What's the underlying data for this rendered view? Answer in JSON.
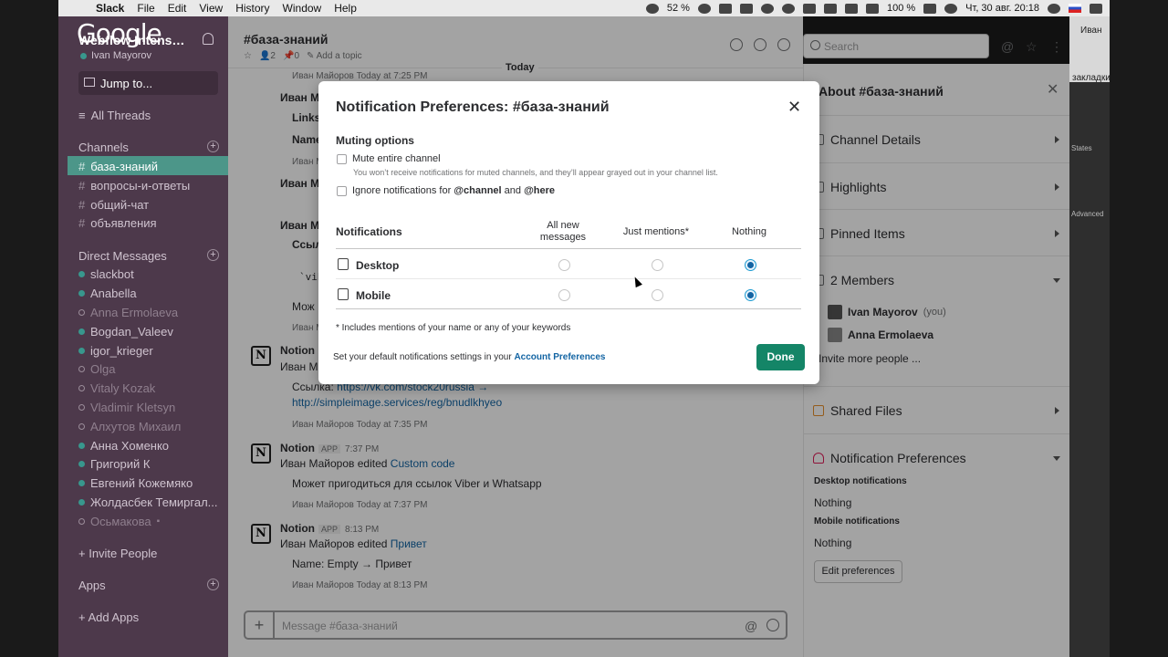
{
  "menubar": {
    "app": "Slack",
    "items": [
      "File",
      "Edit",
      "View",
      "History",
      "Window",
      "Help"
    ],
    "cpu": "52 %",
    "battery": "100 %",
    "clock": "Чт, 30 авг. 20:18"
  },
  "sidebar": {
    "overlay_text": "Google",
    "workspace": "Webflow Intens…",
    "user": "Ivan Mayorov",
    "jump": "Jump to...",
    "all_threads": "All Threads",
    "channels_label": "Channels",
    "channels": [
      "база-знаний",
      "вопросы-и-ответы",
      "общий-чат",
      "объявления"
    ],
    "dm_label": "Direct Messages",
    "dms": [
      {
        "name": "slackbot",
        "online": true
      },
      {
        "name": "Anabella",
        "online": true
      },
      {
        "name": "Anna Ermolaeva",
        "online": false
      },
      {
        "name": "Bogdan_Valeev",
        "online": true
      },
      {
        "name": "igor_krieger",
        "online": true
      },
      {
        "name": "Olga",
        "online": false
      },
      {
        "name": "Vitaly Kozak",
        "online": false
      },
      {
        "name": "Vladimir Kletsyn",
        "online": false
      },
      {
        "name": "Алхутов Михаил",
        "online": false
      },
      {
        "name": "Анна Хоменко",
        "online": true
      },
      {
        "name": "Григорий К",
        "online": true
      },
      {
        "name": "Евгений Кожемяко",
        "online": true
      },
      {
        "name": "Жолдасбек Темиргал...",
        "online": true
      },
      {
        "name": "Осьмакова",
        "online": false
      }
    ],
    "invite": "+ Invite People",
    "apps_label": "Apps",
    "add_apps": "+ Add Apps"
  },
  "channel": {
    "title": "#база-знаний",
    "members": "2",
    "pins": "0",
    "topic": "Add a topic",
    "search_placeholder": "Search",
    "day": "Today",
    "composer_placeholder": "Message #база-знаний"
  },
  "messages": {
    "bg_time1": "Иван Майоров    Today at 7:25 PM",
    "bg_author": "Иван М",
    "bg_links": "Links",
    "bg_name": "Name",
    "bg_sub": "Иван М",
    "bg_ssyl": "Ссыл",
    "bg_vib": "`vib",
    "bg_mozh": "Мож",
    "n1_author": "Notion",
    "n1_line1": "Иван М",
    "n1_ssylka": "Ссылка:",
    "n1_link1": "https://vk.com/stock20russia →",
    "n1_link2": "http://simpleimage.services/reg/bnudlkhyeo",
    "n1_meta": "Иван Майоров    Today at 7:35 PM",
    "n2_author": "Notion",
    "n2_tag": "APP",
    "n2_time": "7:37 PM",
    "n2_line": "Иван Майоров edited",
    "n2_link": "Custom code",
    "n2_body": "Может пригодиться для ссылок Viber и Whatsapp",
    "n2_meta": "Иван Майоров    Today at 7:37 PM",
    "n3_author": "Notion",
    "n3_tag": "APP",
    "n3_time": "8:13 PM",
    "n3_line": "Иван Майоров edited",
    "n3_link": "Привет",
    "n3_body": "Name: Empty → Привет",
    "n3_meta": "Иван Майоров    Today at 8:13 PM"
  },
  "pane": {
    "title": "About #база-знаний",
    "items": [
      "Channel Details",
      "Highlights",
      "Pinned Items",
      "2 Members"
    ],
    "members": [
      {
        "name": "Ivan Mayorov",
        "suffix": "(you)"
      },
      {
        "name": "Anna Ermolaeva",
        "suffix": ""
      }
    ],
    "invite_more": "Invite more people ...",
    "shared_files": "Shared Files",
    "notif_prefs": "Notification Preferences",
    "desktop_h": "Desktop notifications",
    "desktop_v": "Nothing",
    "mobile_h": "Mobile notifications",
    "mobile_v": "Nothing",
    "edit": "Edit preferences"
  },
  "browser": {
    "name": "Иван",
    "bookmarks": "закладки",
    "states": "States",
    "advanced": "Advanced"
  },
  "modal": {
    "title": "Notification Preferences: #база-знаний",
    "muting_label": "Muting options",
    "mute_label": "Mute entire channel",
    "mute_hint": "You won’t receive notifications for muted channels, and they’ll appear grayed out in your channel list.",
    "ignore_prefix": "Ignore notifications for",
    "ignore_channel": "@channel",
    "ignore_and": "and",
    "ignore_here": "@here",
    "notifications_label": "Notifications",
    "col_all_1": "All new",
    "col_all_2": "messages",
    "col_mentions": "Just mentions*",
    "col_nothing": "Nothing",
    "rows": [
      {
        "label": "Desktop",
        "selected": "nothing"
      },
      {
        "label": "Mobile",
        "selected": "nothing"
      }
    ],
    "footnote": "* Includes mentions of your name or any of your keywords",
    "default_text": "Set your default notifications settings in your",
    "account_prefs": "Account Preferences",
    "done": "Done"
  }
}
